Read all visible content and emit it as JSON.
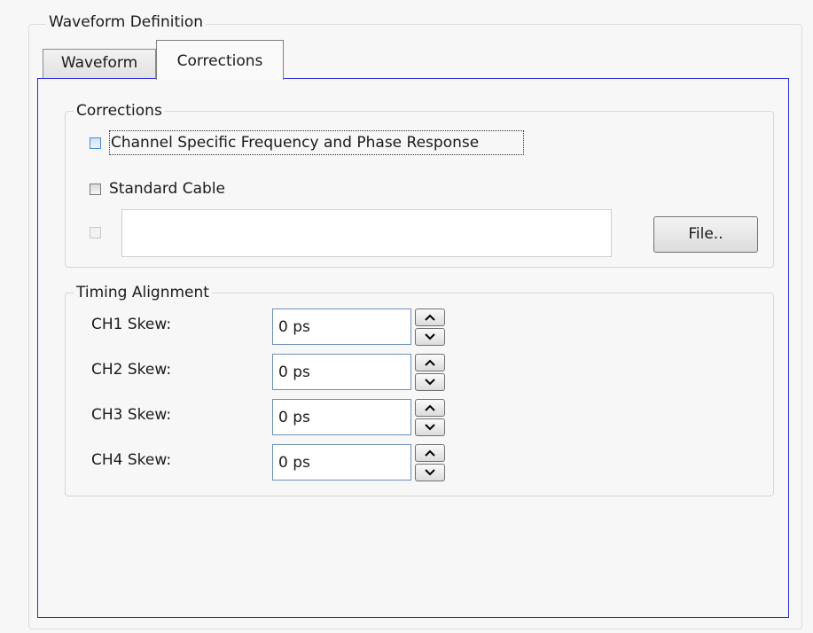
{
  "group_title": "Waveform Definition",
  "tabs": [
    {
      "label": "Waveform",
      "active": false
    },
    {
      "label": "Corrections",
      "active": true
    }
  ],
  "corrections": {
    "title": "Corrections",
    "checkboxes": [
      {
        "label": "Channel Specific Frequency and Phase Response",
        "checked": false
      },
      {
        "label": "Standard Cable",
        "checked": false
      }
    ],
    "file_path_value": "",
    "file_button_label": "File.."
  },
  "timing": {
    "title": "Timing Alignment",
    "rows": [
      {
        "label": "CH1 Skew:",
        "value": "0 ps"
      },
      {
        "label": "CH2 Skew:",
        "value": "0 ps"
      },
      {
        "label": "CH3 Skew:",
        "value": "0 ps"
      },
      {
        "label": "CH4 Skew:",
        "value": "0 ps"
      }
    ]
  },
  "colors": {
    "tab_panel_border": "#2b2bd9",
    "background": "#f7f7f7"
  }
}
